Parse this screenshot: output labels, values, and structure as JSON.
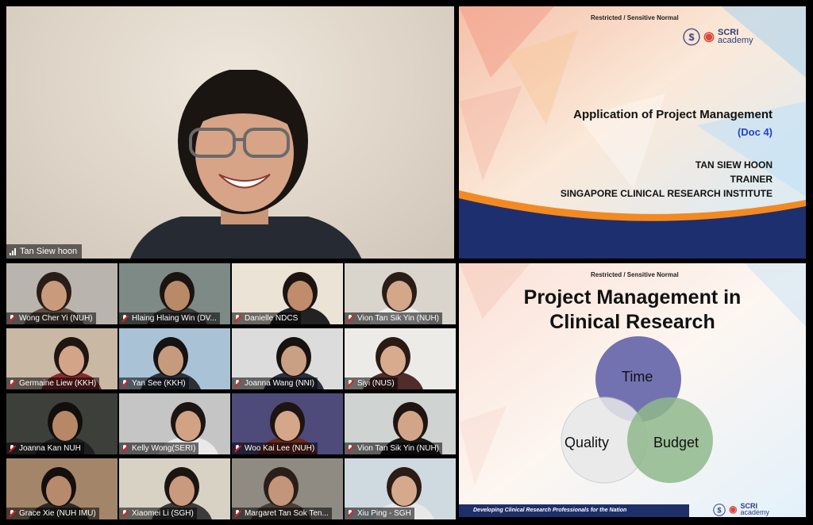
{
  "speaker": {
    "name": "Tan Siew hoon"
  },
  "slide1": {
    "restricted": "Restricted / Sensitive Normal",
    "title": "Application of Project Management",
    "doc": "(Doc 4)",
    "lines": [
      "TAN SIEW HOON",
      "TRAINER",
      "SINGAPORE CLINICAL RESEARCH INSTITUTE"
    ],
    "logo_scri": "SCRI",
    "logo_academy": "academy"
  },
  "slide2": {
    "restricted": "Restricted / Sensitive Normal",
    "title_line1": "Project Management in",
    "title_line2": "Clinical Research",
    "venn": [
      "Time",
      "Quality",
      "Budget"
    ],
    "footer": "Developing Clinical Research Professionals for the Nation",
    "logo_scri": "SCRI",
    "logo_academy": "academy"
  },
  "participants": [
    {
      "name": "Wong Cher Yi (NUH)",
      "bg": "#b9b4ad",
      "shirt": "#5a4c44",
      "skin": "#c99a7c",
      "hair": "#2a1c16"
    },
    {
      "name": "Hlaing Hlaing Win (DV...",
      "bg": "#7d8a86",
      "shirt": "#3a3a3a",
      "skin": "#b98a68",
      "hair": "#1a1410"
    },
    {
      "name": "Danielle NDCS",
      "bg": "#eae3d6",
      "shirt": "#222222",
      "skin": "#c08c6c",
      "hair": "#1c1410"
    },
    {
      "name": "Vion Tan Sik Yin (NUH)",
      "bg": "#d9d5cc",
      "shirt": "#f2f2f2",
      "skin": "#d4a78a",
      "hair": "#2a1c16"
    },
    {
      "name": "Germaine Liew (KKH)",
      "bg": "#c9b8a4",
      "shirt": "#8a2a2a",
      "skin": "#d3a487",
      "hair": "#1f1611"
    },
    {
      "name": "Yan See (KKH)",
      "bg": "#a9c2d6",
      "shirt": "#2b2f3a",
      "skin": "#c69b7d",
      "hair": "#151211"
    },
    {
      "name": "Joanna Wang (NNI)",
      "bg": "#dcdcdc",
      "shirt": "#2a2f3d",
      "skin": "#caa084",
      "hair": "#17120f"
    },
    {
      "name": "Siyi (NUS)",
      "bg": "#ecebe8",
      "shirt": "#4e2d2a",
      "skin": "#d8ab8f",
      "hair": "#2a1a14"
    },
    {
      "name": "Joanna Kan NUH",
      "bg": "#3d3f3a",
      "shirt": "#1e1e1e",
      "skin": "#b78868",
      "hair": "#120e0c"
    },
    {
      "name": "Kelly Wong(SERI)",
      "bg": "#c4c5c4",
      "shirt": "#e9e9e9",
      "skin": "#d1a283",
      "hair": "#1d1512"
    },
    {
      "name": "Woo Kai Lee (NUH)",
      "bg": "#4e4a7a",
      "shirt": "#6a2a1e",
      "skin": "#d6a68a",
      "hair": "#1e1512"
    },
    {
      "name": "Vion Tan Sik Yin (NUH)",
      "bg": "#cfd3d2",
      "shirt": "#1a1a1a",
      "skin": "#d2a588",
      "hair": "#1e1410"
    },
    {
      "name": "Grace Xie (NUH IMU)",
      "bg": "#a3866a",
      "shirt": "#2d2a28",
      "skin": "#b78a6c",
      "hair": "#140f0c"
    },
    {
      "name": "Xiaomei Li (SGH)",
      "bg": "#d7d2c4",
      "shirt": "#3c3b3a",
      "skin": "#c99a7d",
      "hair": "#1c1411"
    },
    {
      "name": "Margaret Tan Sok Ten...",
      "bg": "#8f8b82",
      "shirt": "#4b3f38",
      "skin": "#c3957a",
      "hair": "#2a1e18"
    },
    {
      "name": "Xiu Ping - SGH",
      "bg": "#cfd9e0",
      "shirt": "#e8e8e8",
      "skin": "#d7a98c",
      "hair": "#2a1c16"
    }
  ]
}
